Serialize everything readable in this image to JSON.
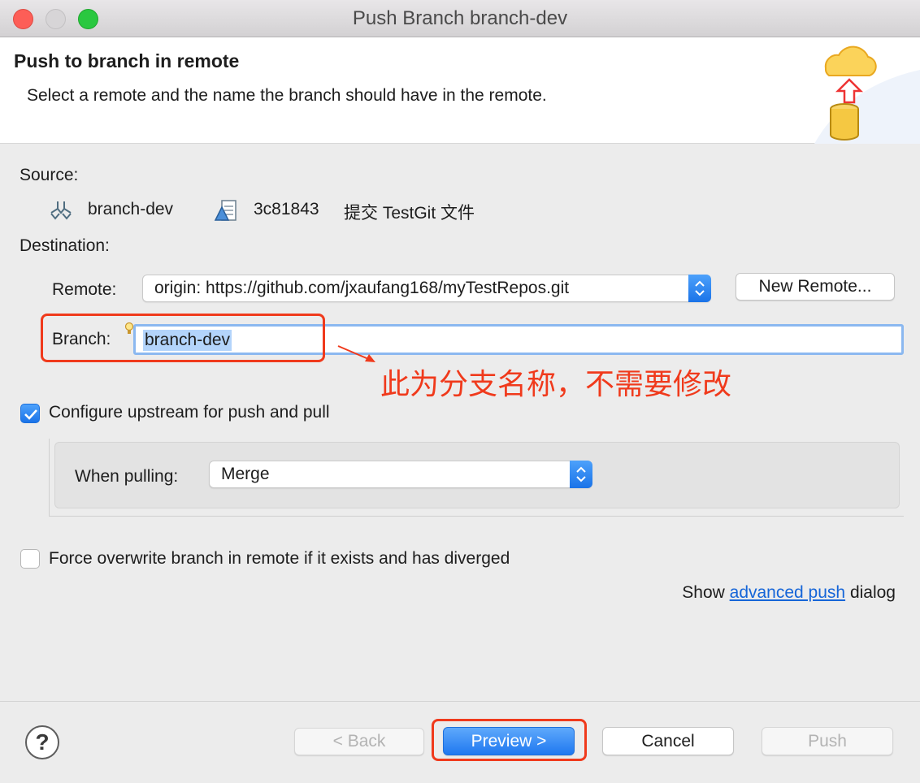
{
  "window": {
    "title": "Push Branch branch-dev"
  },
  "header": {
    "title": "Push to branch in remote",
    "subtitle": "Select a remote and the name the branch should have in the remote.",
    "art_icon": "cloud-push-database-icon"
  },
  "source": {
    "label": "Source:",
    "branch": "branch-dev",
    "branch_icon": "branch-icon",
    "commit_id": "3c81843",
    "commit_message": "提交 TestGit 文件",
    "commit_icon": "commit-icon"
  },
  "destination": {
    "label": "Destination:",
    "remote_label": "Remote:",
    "remote_value": "origin: https://github.com/jxaufang168/myTestRepos.git",
    "new_remote_button": "New Remote...",
    "branch_label": "Branch:",
    "branch_value": "branch-dev",
    "hint_icon": "lightbulb-icon"
  },
  "annotation": {
    "text": "此为分支名称，不需要修改",
    "color": "#f03a1c"
  },
  "upstream": {
    "checkbox_label": "Configure upstream for push and pull",
    "checked": true,
    "when_pulling_label": "When pulling:",
    "when_pulling_value": "Merge"
  },
  "force": {
    "checkbox_label": "Force overwrite branch in remote if it exists and has diverged",
    "checked": false
  },
  "advanced": {
    "prefix": "Show",
    "link": "advanced push",
    "suffix": "dialog"
  },
  "footer": {
    "help_symbol": "?",
    "back_button": "< Back",
    "preview_button": "Preview >",
    "cancel_button": "Cancel",
    "push_button": "Push"
  },
  "colors": {
    "accent": "#1a73e8",
    "annotation": "#f03a1c",
    "link": "#1565d8"
  }
}
